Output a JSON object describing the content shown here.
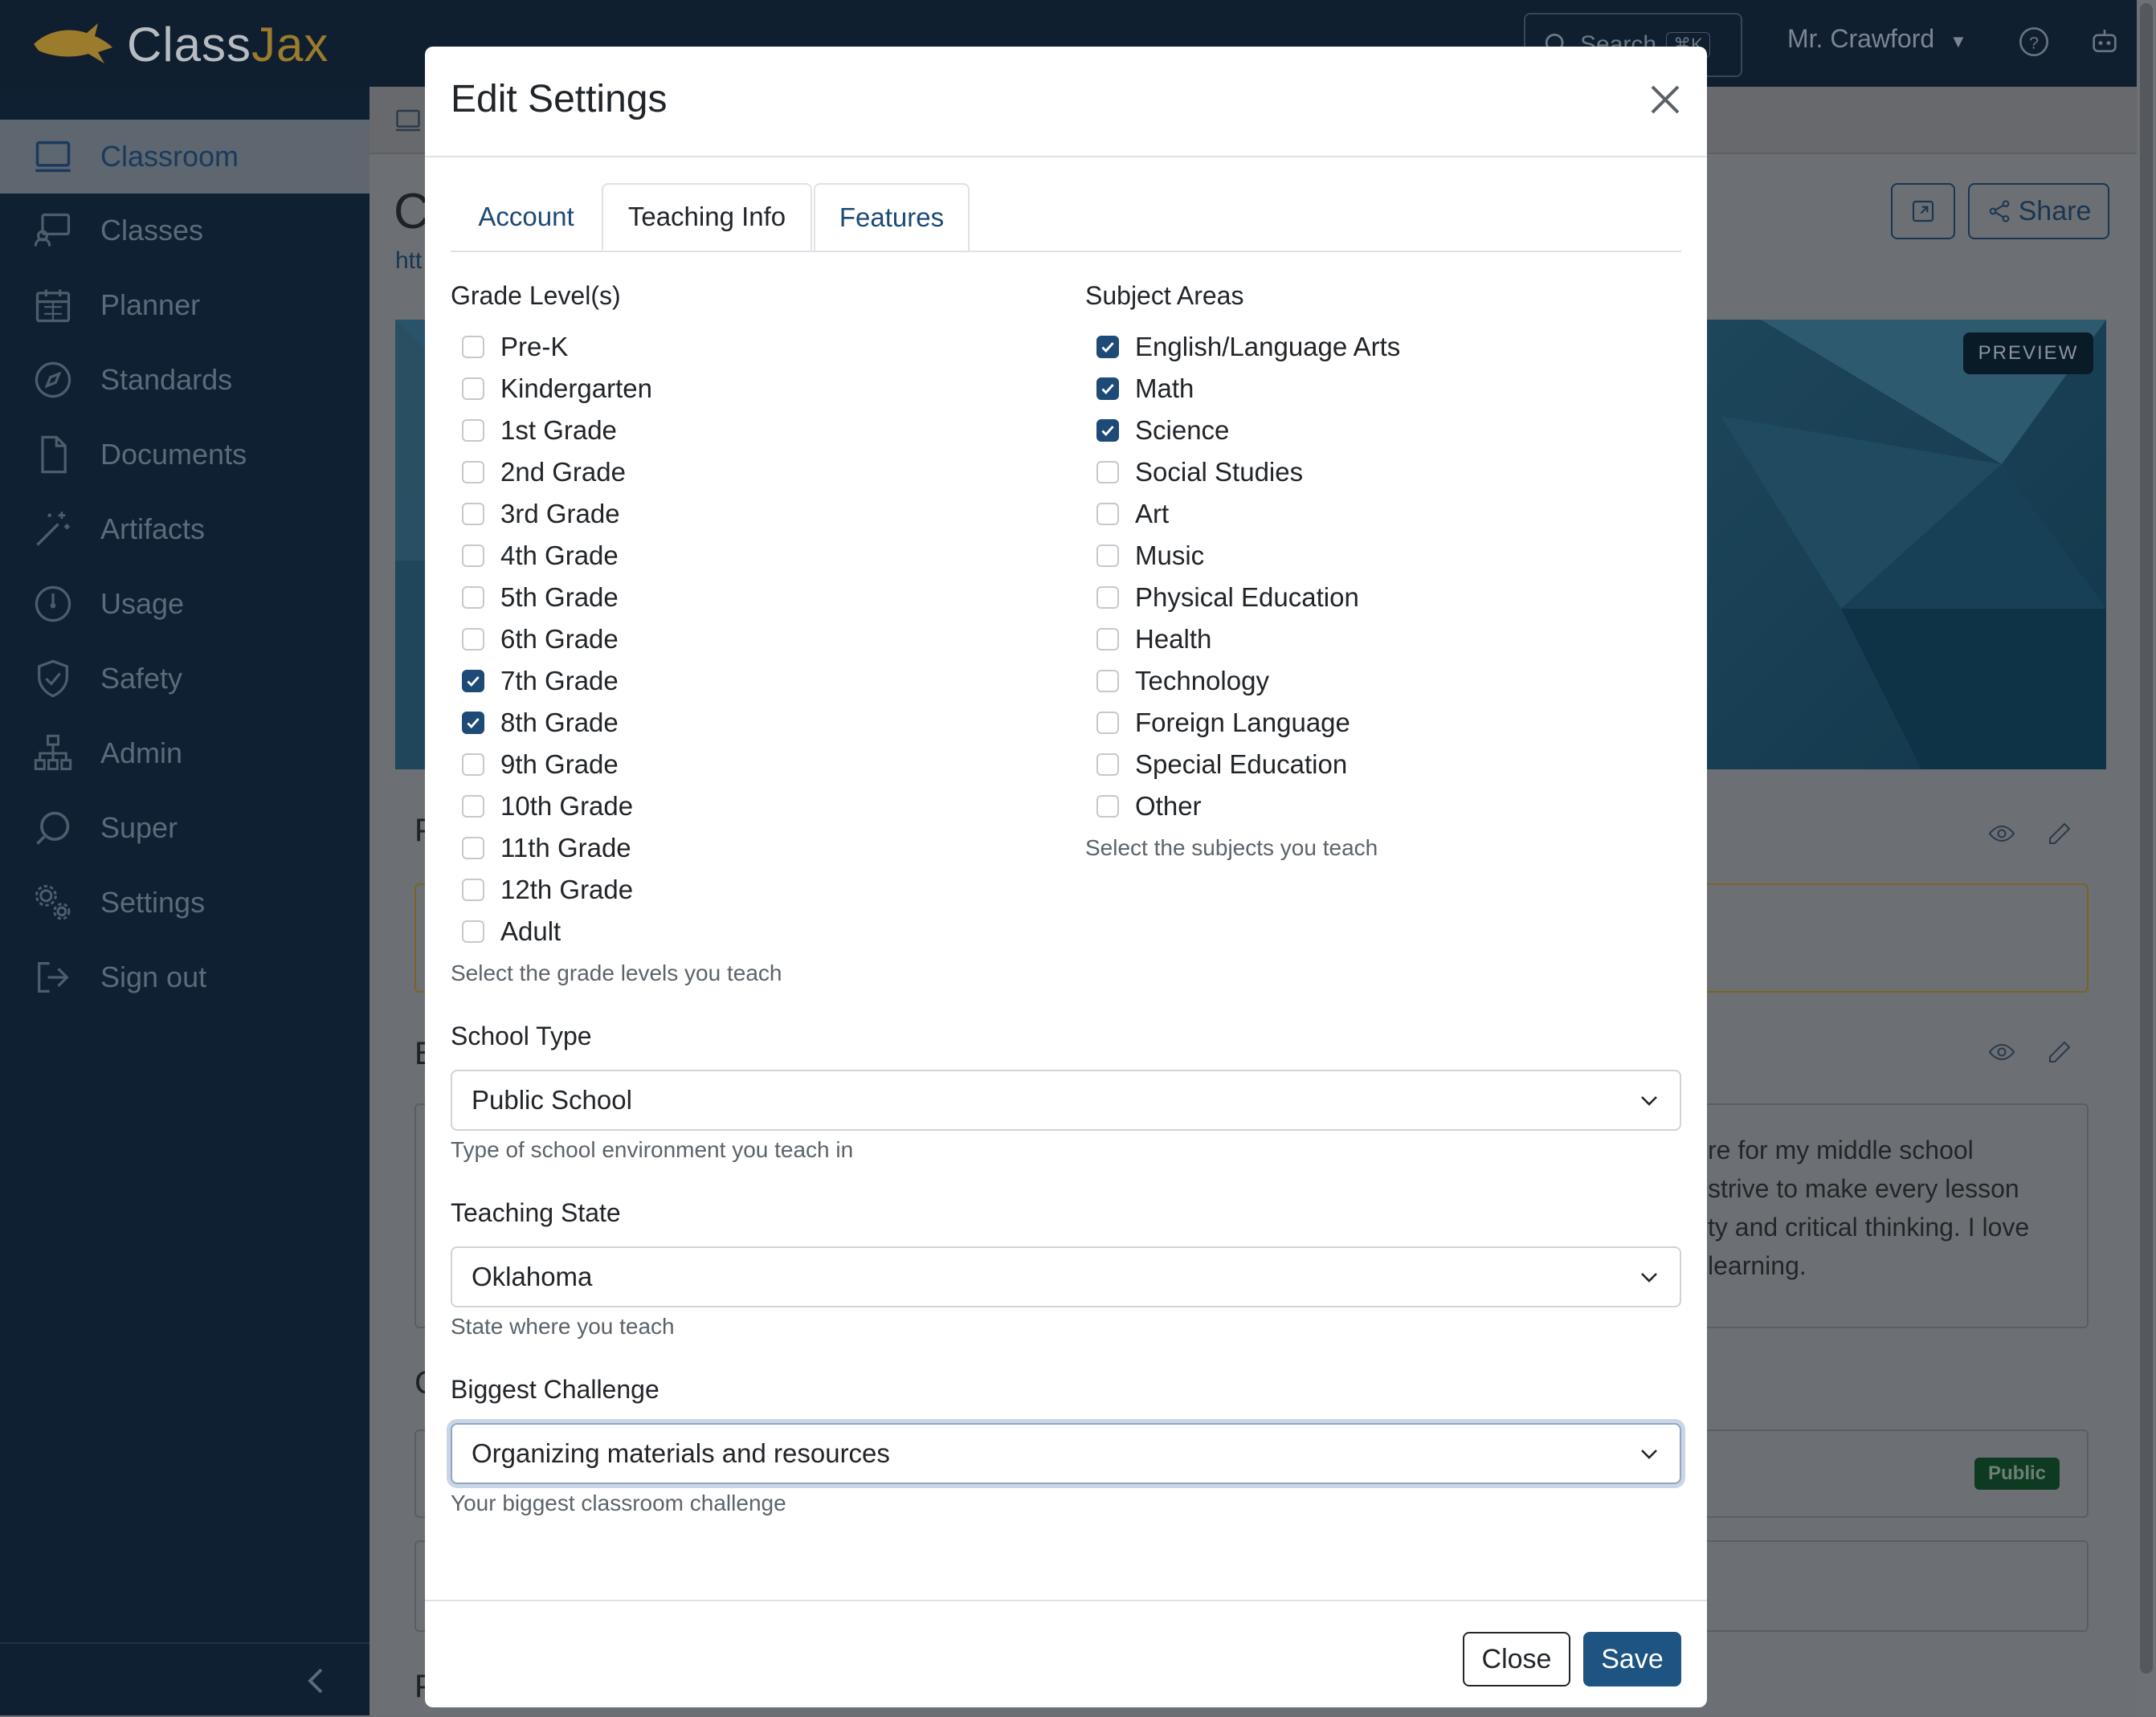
{
  "app": {
    "logo_left": "Class",
    "logo_right": "Jax",
    "search_placeholder": "Search",
    "search_shortcut": "⌘K",
    "user_name": "Mr. Crawford",
    "user_caret_icon": "caret-down-icon",
    "help_icon": "help-circle-icon",
    "bot_icon": "robot-icon"
  },
  "sidebar": {
    "items": [
      {
        "label": "Classroom",
        "icon": "classroom-icon",
        "active": true
      },
      {
        "label": "Classes",
        "icon": "classes-icon"
      },
      {
        "label": "Planner",
        "icon": "calendar-icon"
      },
      {
        "label": "Standards",
        "icon": "compass-icon"
      },
      {
        "label": "Documents",
        "icon": "document-icon"
      },
      {
        "label": "Artifacts",
        "icon": "magic-wand-icon"
      },
      {
        "label": "Usage",
        "icon": "gauge-icon"
      },
      {
        "label": "Safety",
        "icon": "shield-check-icon"
      },
      {
        "label": "Admin",
        "icon": "hierarchy-icon"
      },
      {
        "label": "Super",
        "icon": "super-icon"
      },
      {
        "label": "Settings",
        "icon": "gears-icon"
      },
      {
        "label": "Sign out",
        "icon": "sign-out-icon"
      }
    ],
    "collapse_icon": "chevron-left-icon"
  },
  "background": {
    "heading_initial": "C",
    "link_fragment": "htt",
    "share_label": "Share",
    "preview_label": "PREVIEW",
    "bio_lines": [
      "re for my middle school",
      "strive to make every lesson",
      "ty and critical thinking. I love",
      "learning."
    ],
    "section_initials": [
      "P",
      "B",
      "C",
      "P"
    ],
    "public_badge": "Public"
  },
  "modal": {
    "title": "Edit Settings",
    "tabs": [
      {
        "label": "Account",
        "active": false
      },
      {
        "label": "Teaching Info",
        "active": true
      },
      {
        "label": "Features",
        "active": false
      }
    ],
    "grade_levels": {
      "label": "Grade Level(s)",
      "options": [
        {
          "label": "Pre-K",
          "checked": false
        },
        {
          "label": "Kindergarten",
          "checked": false
        },
        {
          "label": "1st Grade",
          "checked": false
        },
        {
          "label": "2nd Grade",
          "checked": false
        },
        {
          "label": "3rd Grade",
          "checked": false
        },
        {
          "label": "4th Grade",
          "checked": false
        },
        {
          "label": "5th Grade",
          "checked": false
        },
        {
          "label": "6th Grade",
          "checked": false
        },
        {
          "label": "7th Grade",
          "checked": true
        },
        {
          "label": "8th Grade",
          "checked": true
        },
        {
          "label": "9th Grade",
          "checked": false
        },
        {
          "label": "10th Grade",
          "checked": false
        },
        {
          "label": "11th Grade",
          "checked": false
        },
        {
          "label": "12th Grade",
          "checked": false
        },
        {
          "label": "Adult",
          "checked": false
        }
      ],
      "help": "Select the grade levels you teach"
    },
    "subject_areas": {
      "label": "Subject Areas",
      "options": [
        {
          "label": "English/Language Arts",
          "checked": true
        },
        {
          "label": "Math",
          "checked": true
        },
        {
          "label": "Science",
          "checked": true
        },
        {
          "label": "Social Studies",
          "checked": false
        },
        {
          "label": "Art",
          "checked": false
        },
        {
          "label": "Music",
          "checked": false
        },
        {
          "label": "Physical Education",
          "checked": false
        },
        {
          "label": "Health",
          "checked": false
        },
        {
          "label": "Technology",
          "checked": false
        },
        {
          "label": "Foreign Language",
          "checked": false
        },
        {
          "label": "Special Education",
          "checked": false
        },
        {
          "label": "Other",
          "checked": false
        }
      ],
      "help": "Select the subjects you teach"
    },
    "school_type": {
      "label": "School Type",
      "value": "Public School",
      "help": "Type of school environment you teach in"
    },
    "teaching_state": {
      "label": "Teaching State",
      "value": "Oklahoma",
      "help": "State where you teach"
    },
    "biggest_challenge": {
      "label": "Biggest Challenge",
      "value": "Organizing materials and resources",
      "help": "Your biggest classroom challenge"
    },
    "footer": {
      "close_label": "Close",
      "save_label": "Save"
    }
  }
}
